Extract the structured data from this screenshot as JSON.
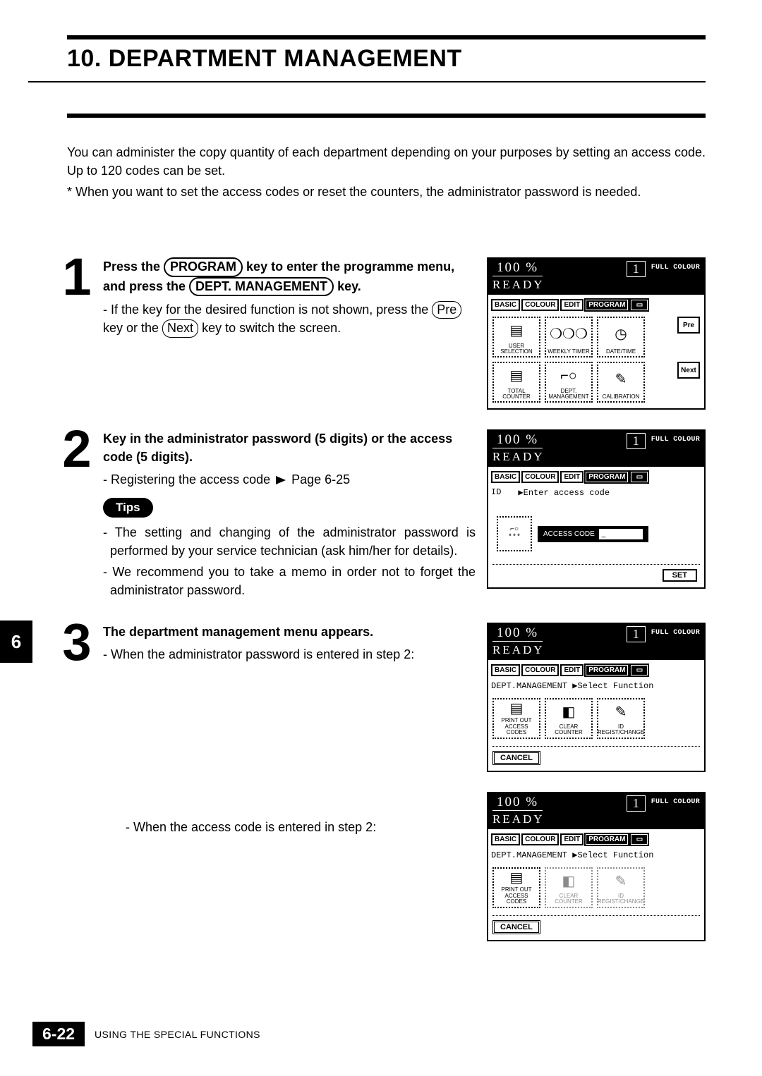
{
  "page": {
    "title": "10. DEPARTMENT MANAGEMENT",
    "intro_p1": "You can administer the copy quantity of each department depending on your purposes by setting an access code.  Up to 120 codes can be set.",
    "intro_note": "* When you want to set the access codes or reset the counters, the administrator password is needed.",
    "side_tab": "6",
    "page_number": "6-22",
    "footer_label": "USING THE SPECIAL FUNCTIONS"
  },
  "keys": {
    "program": "PROGRAM",
    "dept_mgmt": "DEPT. MANAGEMENT",
    "pre": "Pre",
    "next": "Next"
  },
  "step1": {
    "num": "1",
    "bold_a": "Press the ",
    "bold_b": " key to enter the programme menu, and  press the ",
    "bold_c": " key.",
    "sub": "- If the key for the desired function is not shown, press the ",
    "sub_mid": " key or the ",
    "sub_end": " key to switch the screen."
  },
  "step2": {
    "num": "2",
    "bold": "Key in the administrator password (5 digits) or the access code (5 digits).",
    "sub_a": "- Registering the access code ",
    "sub_page": " Page 6-25",
    "tips_label": "Tips",
    "tip1": "The setting and changing of the administrator password is performed by your service technician (ask him/her for details).",
    "tip2": "We recommend you to take a memo in order not to forget the administrator password."
  },
  "step3": {
    "num": "3",
    "bold": "The department management menu appears.",
    "sub_admin": "- When the administrator password is entered in step 2:",
    "sub_access": "- When the access code is entered in step 2:"
  },
  "lcd": {
    "pct": "100  %",
    "count": "1",
    "mode": "FULL COLOUR",
    "ready": "READY",
    "tabs": {
      "basic": "BASIC",
      "colour": "COLOUR",
      "edit": "EDIT",
      "program": "PROGRAM"
    },
    "s1": {
      "cells": [
        "USER SELECTION",
        "WEEKLY TIMER",
        "DATE/TIME",
        "TOTAL COUNTER",
        "DEPT. MANAGEMENT",
        "CALIBRATION"
      ],
      "pre": "Pre",
      "next": "Next"
    },
    "s2": {
      "id": "ID",
      "prompt": "▶Enter access code",
      "access_label": "ACCESS CODE",
      "access_value": "_",
      "key_stars": "***",
      "set": "SET"
    },
    "s3": {
      "subhead": "DEPT.MANAGEMENT  ▶Select Function",
      "cells": [
        "PRINT OUT ACCESS CODES",
        "CLEAR COUNTER",
        "ID REGIST/CHANGE"
      ],
      "cancel": "CANCEL"
    }
  }
}
